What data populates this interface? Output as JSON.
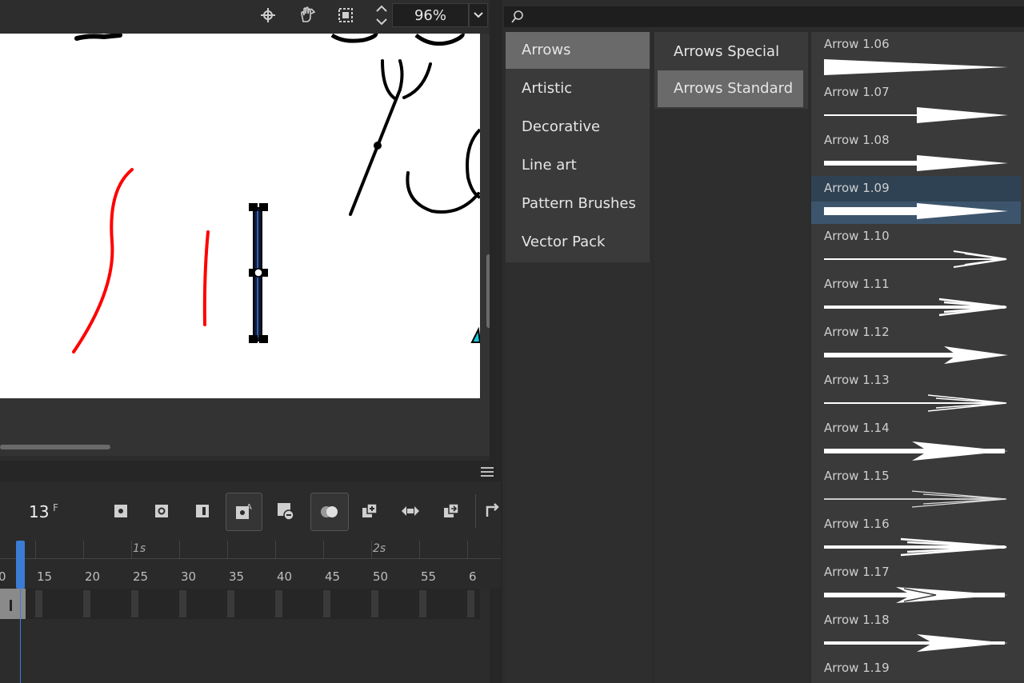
{
  "stage": {
    "zoom": "96%"
  },
  "timeline": {
    "current_frame": "13",
    "frame_unit": "F",
    "second_labels": [
      "1s",
      "2s"
    ],
    "tick_labels": [
      "0",
      "15",
      "20",
      "25",
      "30",
      "35",
      "40",
      "45",
      "50",
      "55",
      "6"
    ]
  },
  "brushes": {
    "categories": [
      {
        "label": "Arrows",
        "selected": true
      },
      {
        "label": "Artistic",
        "selected": false
      },
      {
        "label": "Decorative",
        "selected": false
      },
      {
        "label": "Line art",
        "selected": false
      },
      {
        "label": "Pattern Brushes",
        "selected": false
      },
      {
        "label": "Vector Pack",
        "selected": false
      }
    ],
    "subcategories": [
      {
        "label": "Arrows Special",
        "selected": false
      },
      {
        "label": "Arrows Standard",
        "selected": true
      }
    ],
    "items": [
      {
        "label": "Arrow 1.06"
      },
      {
        "label": "Arrow 1.07"
      },
      {
        "label": "Arrow 1.08"
      },
      {
        "label": "Arrow 1.09",
        "selected": true
      },
      {
        "label": "Arrow 1.10"
      },
      {
        "label": "Arrow 1.11"
      },
      {
        "label": "Arrow 1.12"
      },
      {
        "label": "Arrow 1.13"
      },
      {
        "label": "Arrow 1.14"
      },
      {
        "label": "Arrow 1.15"
      },
      {
        "label": "Arrow 1.16"
      },
      {
        "label": "Arrow 1.17"
      },
      {
        "label": "Arrow 1.18"
      },
      {
        "label": "Arrow 1.19"
      }
    ]
  },
  "colors": {
    "accent_blue": "#3b7cd6",
    "selection_blue": "#2f4254",
    "stroke_red": "#ff0000"
  }
}
